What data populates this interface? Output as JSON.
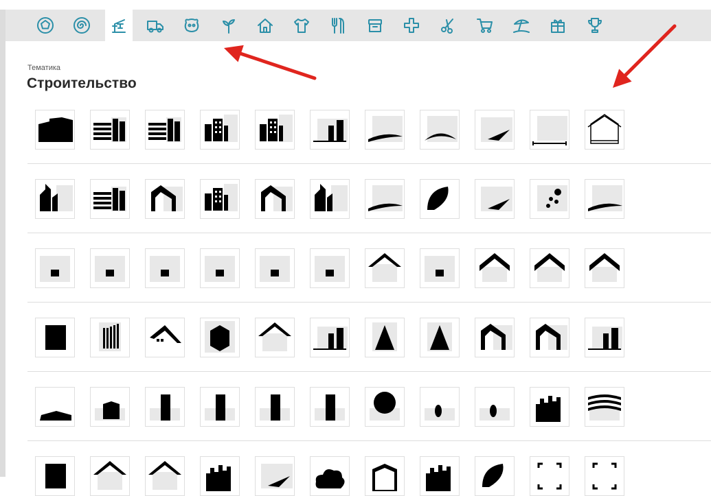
{
  "section": {
    "label": "Тематика",
    "title": "Строительство"
  },
  "categories": [
    {
      "icon": "pentagon-ring-icon"
    },
    {
      "icon": "spiral-icon"
    },
    {
      "icon": "construction-crane-icon",
      "active": true
    },
    {
      "icon": "truck-icon"
    },
    {
      "icon": "pet-icon"
    },
    {
      "icon": "plant-icon"
    },
    {
      "icon": "house-icon"
    },
    {
      "icon": "tshirt-icon"
    },
    {
      "icon": "restaurant-icon"
    },
    {
      "icon": "box-icon"
    },
    {
      "icon": "medical-cross-icon"
    },
    {
      "icon": "scissors-icon"
    },
    {
      "icon": "shopping-cart-icon"
    },
    {
      "icon": "beach-icon"
    },
    {
      "icon": "gift-icon"
    },
    {
      "icon": "trophy-icon"
    }
  ],
  "colors": {
    "accent": "#2b8fa8",
    "arrow": "#e0251e",
    "tile_bg": "#e8e8e8"
  },
  "logo_rows": [
    [
      "buildings-logo",
      "stripes-logo",
      "stripes-logo",
      "grid-tower-logo",
      "grid-tower-logo",
      "towers-logo",
      "swoosh-logo",
      "arc-logo",
      "wing-logo",
      "measure-logo",
      "house-outline-logo"
    ],
    [
      "skyscraper-logo",
      "stripes-logo",
      "arch-logo",
      "grid-tower-logo",
      "arch-logo",
      "skyscraper-logo",
      "swoosh-logo",
      "leaf-logo",
      "wing-logo",
      "dots-logo",
      "swoosh-logo"
    ],
    [
      "house-logo",
      "house-logo",
      "house-logo",
      "house-logo",
      "house-logo",
      "house-logo",
      "roof-logo",
      "house-logo",
      "chevron-logo",
      "chevron-logo",
      "chevron-logo"
    ],
    [
      "rectangle-logo",
      "columns-logo",
      "house-roof-logo",
      "stack-logo",
      "roof-logo",
      "towers-logo",
      "spire-logo",
      "spire-logo",
      "arch-logo",
      "arch-logo",
      "towers-logo"
    ],
    [
      "hill-logo",
      "block-logo",
      "tower-logo",
      "tower-logo",
      "tower-logo",
      "tower-logo",
      "ball-logo",
      "tree-logo",
      "tree-logo",
      "city-logo",
      "wave-stripes-logo"
    ],
    [
      "rectangle-logo",
      "roof-logo",
      "roof-logo",
      "city-logo",
      "wing-logo",
      "cloud-logo",
      "frame-logo",
      "city-logo",
      "leaf-logo",
      "corners-logo",
      "corners-logo"
    ]
  ]
}
